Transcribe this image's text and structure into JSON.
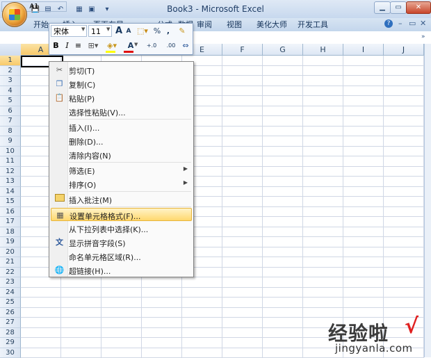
{
  "window": {
    "title": "Book3 - Microsoft Excel",
    "minimize": "▁",
    "maximize": "▭",
    "close": "✕"
  },
  "ribbon": {
    "tabs": [
      "开始",
      "插入",
      "页面布局",
      "公式",
      "数据",
      "审阅",
      "视图",
      "美化大师",
      "开发工具"
    ],
    "help": "?"
  },
  "formula_bar": {
    "name_box": "A1"
  },
  "mini_toolbar": {
    "font": "宋体",
    "size": "11",
    "grow": "A",
    "shrink": "A",
    "percent": "%",
    "comma": ",",
    "bold": "B",
    "italic": "I",
    "center": "≡",
    "font_color": "A",
    "inc_decimal": "+.0",
    "dec_decimal": ".00"
  },
  "columns": [
    "A",
    "B",
    "C",
    "D",
    "E",
    "F",
    "G",
    "H",
    "I",
    "J"
  ],
  "rows": [
    "1",
    "2",
    "3",
    "4",
    "5",
    "6",
    "7",
    "8",
    "9",
    "10",
    "11",
    "12",
    "13",
    "14",
    "15",
    "16",
    "17",
    "18",
    "19",
    "20",
    "21",
    "22",
    "23",
    "24",
    "25",
    "26",
    "27",
    "28",
    "29",
    "30"
  ],
  "context_menu": {
    "items": [
      {
        "label": "剪切(T)",
        "icon": "scissors-icon"
      },
      {
        "label": "复制(C)",
        "icon": "copy-icon"
      },
      {
        "label": "粘贴(P)",
        "icon": "paste-icon"
      },
      {
        "label": "选择性粘贴(V)..."
      },
      {
        "label": "插入(I)..."
      },
      {
        "label": "删除(D)..."
      },
      {
        "label": "清除内容(N)"
      },
      {
        "label": "筛选(E)",
        "submenu": true
      },
      {
        "label": "排序(O)",
        "submenu": true
      },
      {
        "label": "插入批注(M)",
        "icon": "comment-icon"
      },
      {
        "label": "设置单元格格式(F)...",
        "icon": "format-cells-icon",
        "highlighted": true
      },
      {
        "label": "从下拉列表中选择(K)..."
      },
      {
        "label": "显示拼音字段(S)",
        "icon": "phonetic-icon"
      },
      {
        "label": "命名单元格区域(R)..."
      },
      {
        "label": "超链接(H)...",
        "icon": "hyperlink-icon"
      }
    ]
  },
  "watermark": {
    "brand": "经验啦",
    "check": "√",
    "url": "jingyanla.com"
  },
  "colors": {
    "accent": "#2b579a",
    "highlight": "#ffd86e",
    "header_selected": "#f8c96a"
  }
}
